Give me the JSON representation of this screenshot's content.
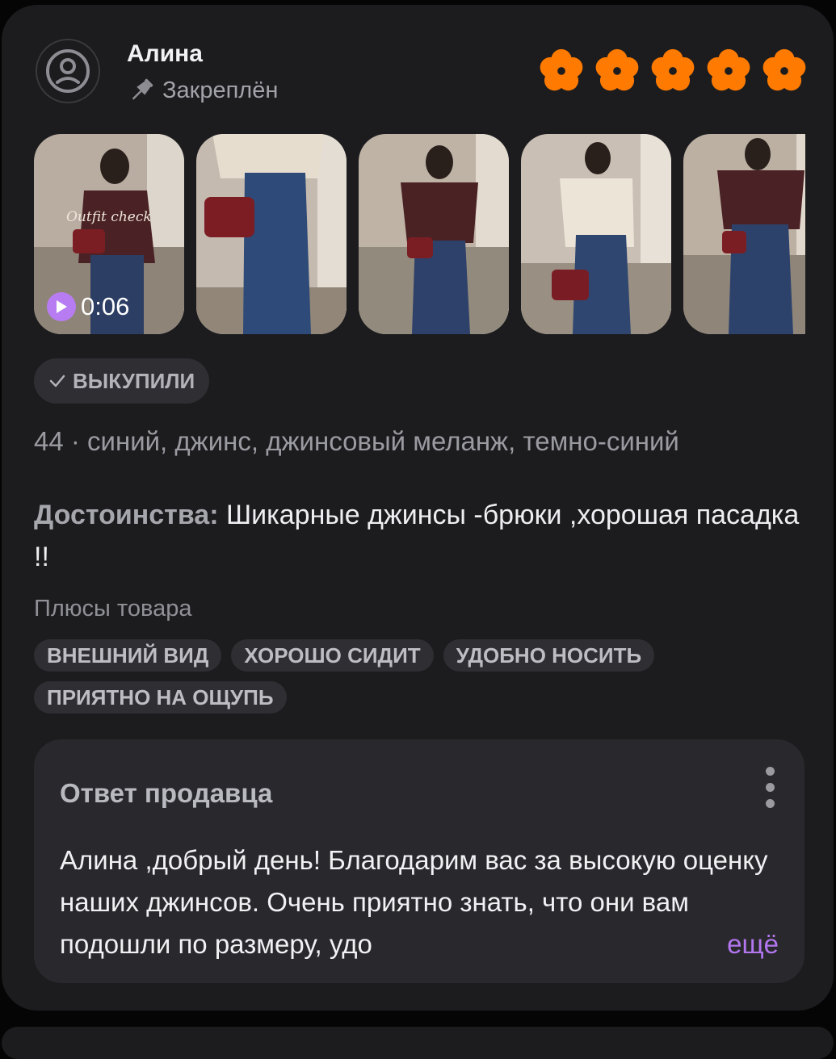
{
  "review": {
    "author": "Алина",
    "pinned_label": "Закреплён",
    "rating": 5,
    "star_color": "#ff7a00",
    "video_duration": "0:06",
    "photo_watermark": "Outfit check",
    "badge": "ВЫКУПИЛИ",
    "variant": "44 · синий, джинс, джинсовый меланж, темно-синий",
    "pros_label": "Достоинства:",
    "pros_text": "Шикарные джинсы -брюки ,хорошая пасадка !!",
    "plus_title": "Плюсы товара",
    "tags": [
      "ВНЕШНИЙ ВИД",
      "ХОРОШО СИДИТ",
      "УДОБНО НОСИТЬ",
      "ПРИЯТНО НА ОЩУПЬ"
    ]
  },
  "seller_reply": {
    "title": "Ответ продавца",
    "text": "Алина ,добрый день! Благодарим вас за высокую оценку наших джинсов. Очень приятно знать, что они вам подошли по размеру, удо",
    "more_label": "ещё"
  },
  "colors": {
    "accent": "#b77cf2",
    "card_bg": "#1c1c1f",
    "chip_bg": "#2e2e33"
  }
}
